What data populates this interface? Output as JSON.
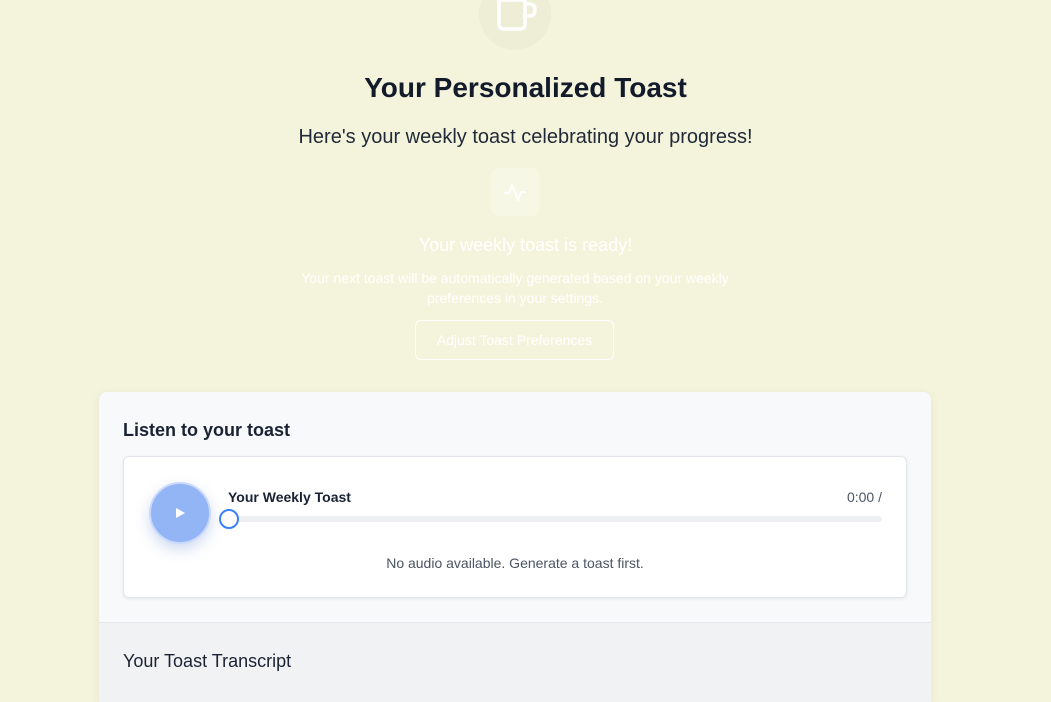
{
  "header": {
    "icon": "coffee-cup-icon",
    "title": "Your Personalized Toast",
    "subtitle": "Here's your weekly toast celebrating your progress!"
  },
  "status": {
    "icon": "activity-icon",
    "title": "Your weekly toast is ready!",
    "description": "Your next toast will be automatically generated based on your weekly preferences in your settings.",
    "button_label": "Adjust Toast Preferences"
  },
  "audio_card": {
    "heading": "Listen to your toast",
    "player": {
      "play_icon": "play-icon",
      "track_title": "Your Weekly Toast",
      "time": "0:00 /",
      "progress": 0,
      "empty_message": "No audio available. Generate a toast first."
    }
  },
  "transcript": {
    "heading": "Your Toast Transcript"
  },
  "colors": {
    "background": "#f4f4dc",
    "accent": "#3b82f6",
    "play_button": "#93b4f5"
  }
}
